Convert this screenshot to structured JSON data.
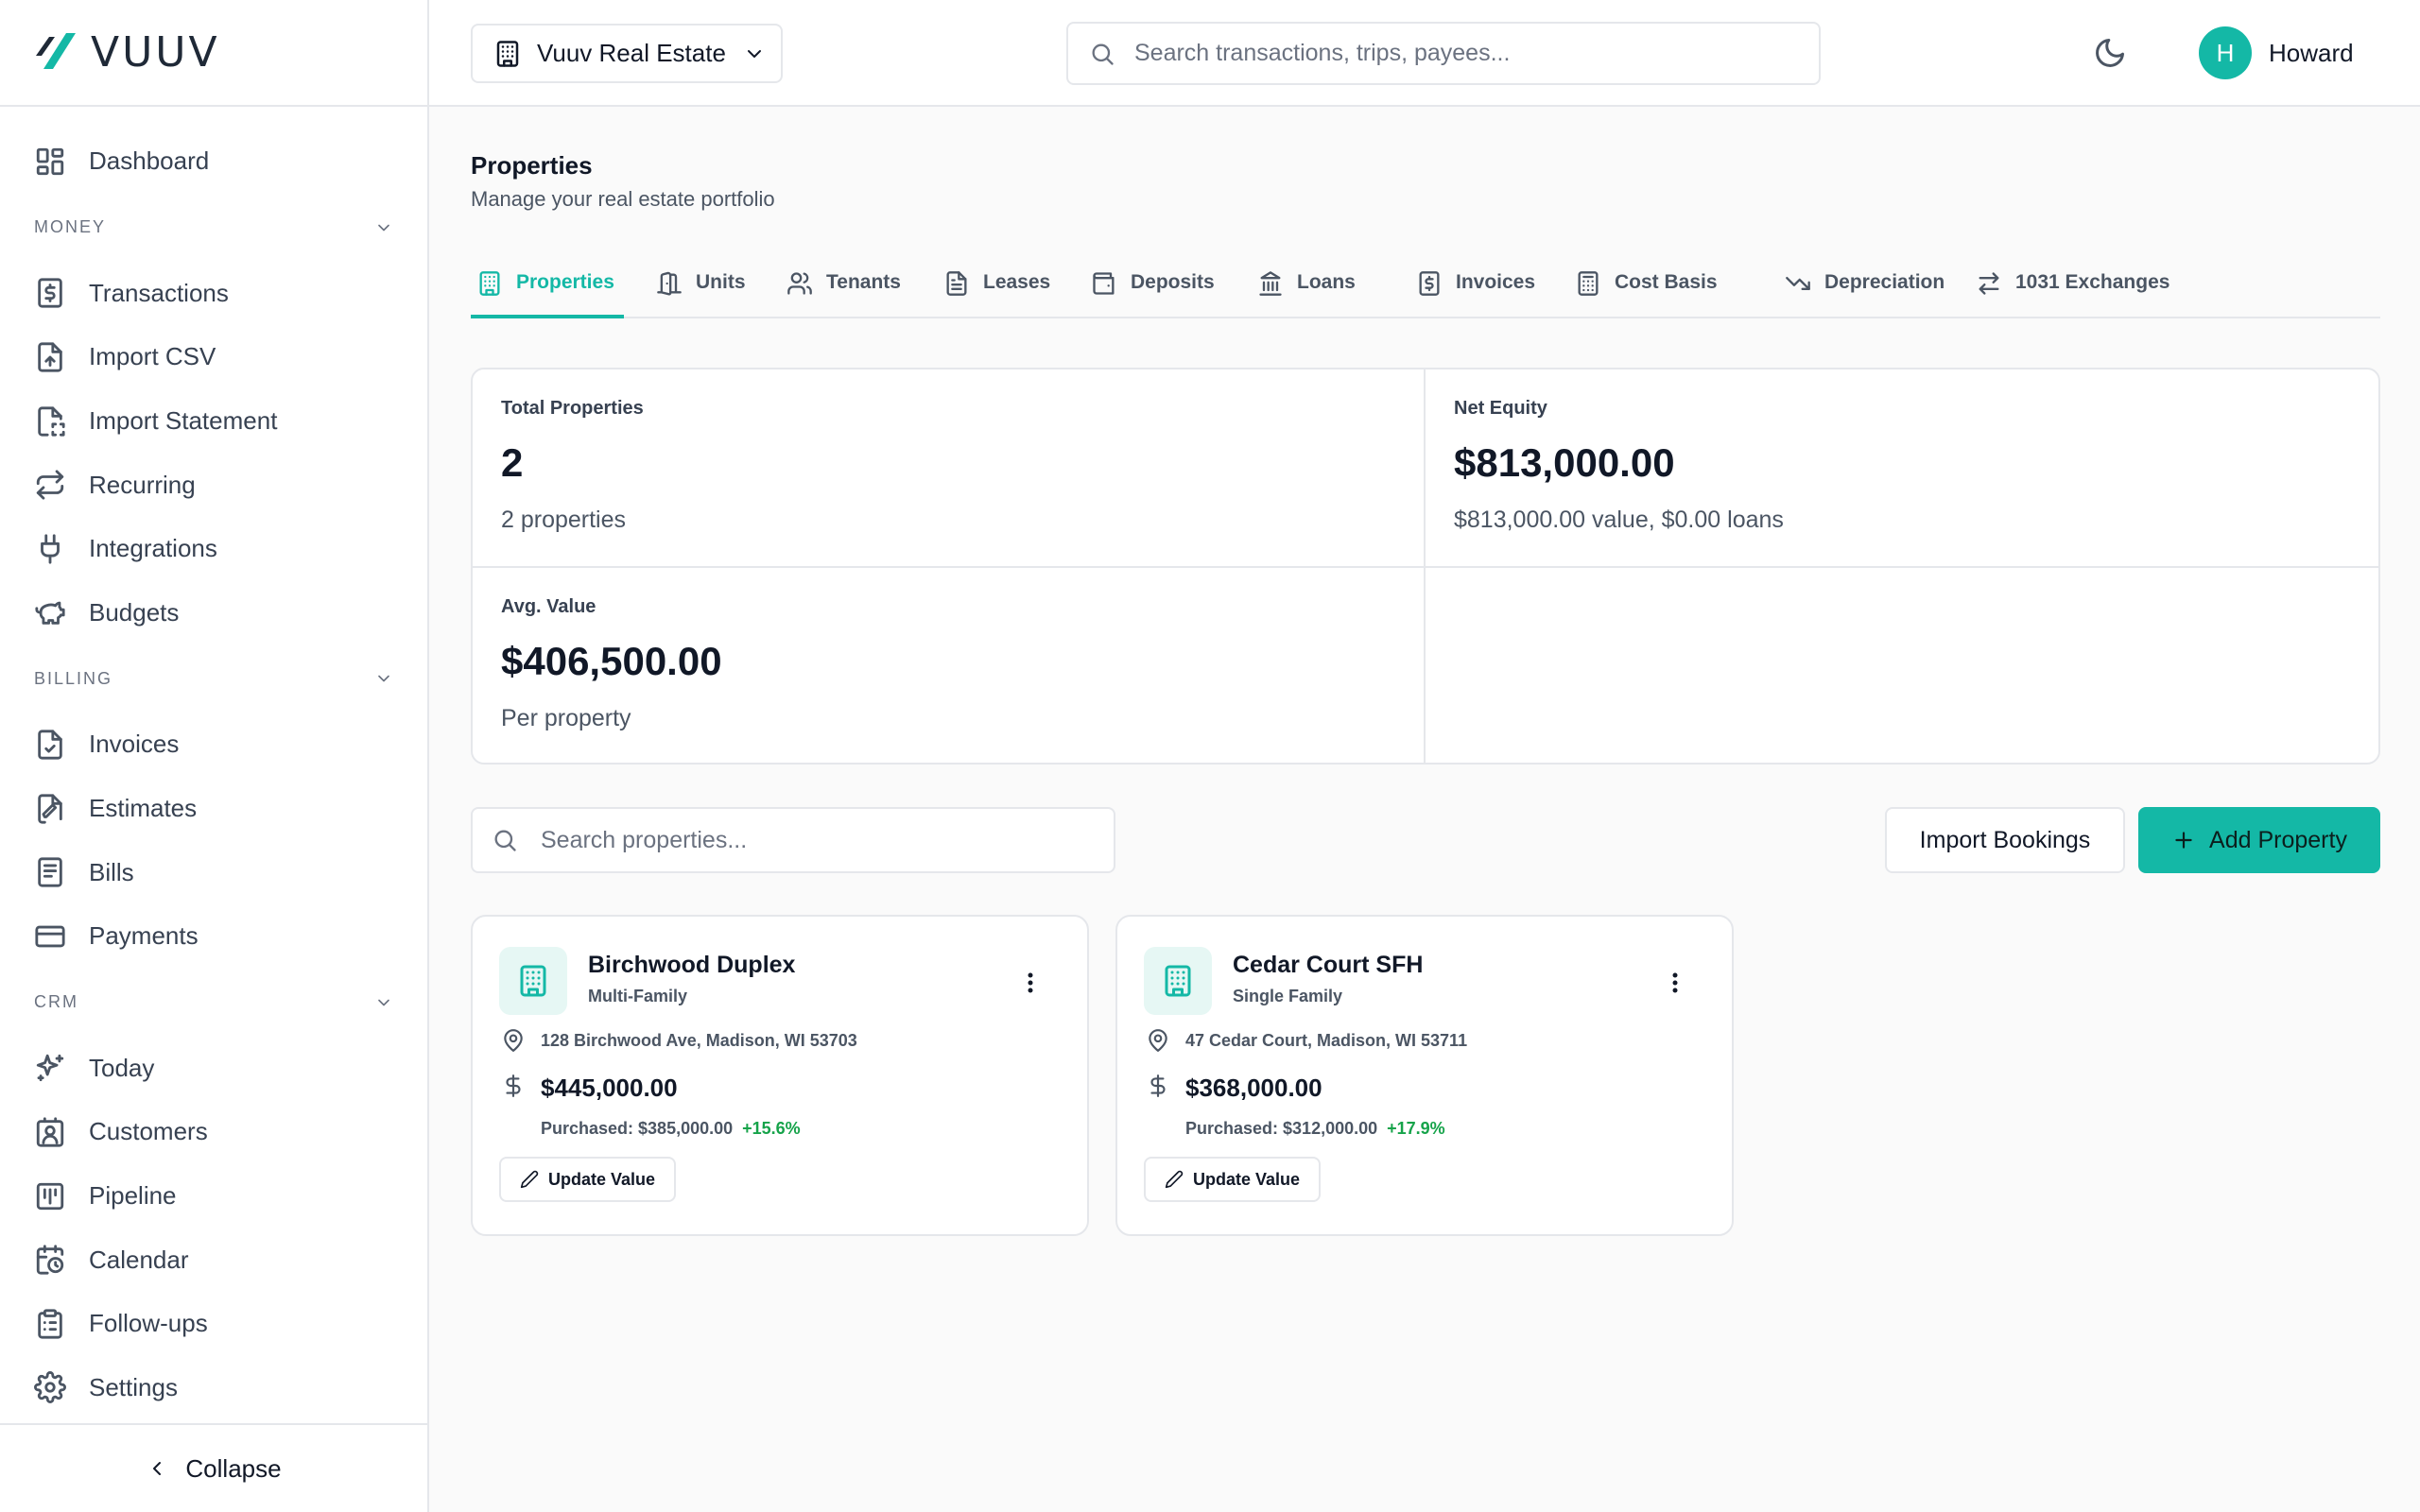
{
  "brand": {
    "name": "VUUV"
  },
  "colors": {
    "accent": "#14b8a6",
    "positive": "#16a34a",
    "border": "#e5e7eb"
  },
  "sidebar": {
    "top_items": [
      {
        "label": "Dashboard",
        "icon": "dashboard-icon"
      }
    ],
    "sections": [
      {
        "title": "MONEY",
        "items": [
          {
            "label": "Transactions",
            "icon": "receipt-dollar-icon"
          },
          {
            "label": "Import CSV",
            "icon": "file-upload-icon"
          },
          {
            "label": "Import Statement",
            "icon": "file-scan-icon"
          },
          {
            "label": "Recurring",
            "icon": "repeat-icon"
          },
          {
            "label": "Integrations",
            "icon": "plug-icon"
          },
          {
            "label": "Budgets",
            "icon": "piggy-bank-icon"
          }
        ]
      },
      {
        "title": "BILLING",
        "items": [
          {
            "label": "Invoices",
            "icon": "file-check-icon"
          },
          {
            "label": "Estimates",
            "icon": "file-signature-icon"
          },
          {
            "label": "Bills",
            "icon": "bill-icon"
          },
          {
            "label": "Payments",
            "icon": "credit-card-icon"
          }
        ]
      },
      {
        "title": "CRM",
        "items": [
          {
            "label": "Today",
            "icon": "sparkles-icon"
          },
          {
            "label": "Customers",
            "icon": "contact-icon"
          },
          {
            "label": "Pipeline",
            "icon": "pipeline-icon"
          },
          {
            "label": "Calendar",
            "icon": "calendar-clock-icon"
          },
          {
            "label": "Follow-ups",
            "icon": "clipboard-list-icon"
          }
        ]
      }
    ],
    "bottom_items": [
      {
        "label": "Settings",
        "icon": "gear-icon"
      }
    ],
    "collapse_label": "Collapse"
  },
  "header": {
    "org_name": "Vuuv Real Estate",
    "search_placeholder": "Search transactions, trips, payees...",
    "user": {
      "initial": "H",
      "name": "Howard"
    }
  },
  "page": {
    "title": "Properties",
    "subtitle": "Manage your real estate portfolio"
  },
  "tabs": [
    {
      "label": "Properties",
      "icon": "building-icon",
      "active": true
    },
    {
      "label": "Units",
      "icon": "door-icon",
      "active": false
    },
    {
      "label": "Tenants",
      "icon": "users-icon",
      "active": false
    },
    {
      "label": "Leases",
      "icon": "file-text-icon",
      "active": false
    },
    {
      "label": "Deposits",
      "icon": "wallet-icon",
      "active": false
    },
    {
      "label": "Loans",
      "icon": "bank-icon",
      "active": false
    },
    {
      "label": "Invoices",
      "icon": "receipt-dollar-icon",
      "active": false
    },
    {
      "label": "Cost Basis",
      "icon": "calculator-icon",
      "active": false
    },
    {
      "label": "Depreciation",
      "icon": "trending-down-icon",
      "active": false
    },
    {
      "label": "1031 Exchanges",
      "icon": "arrows-exchange-icon",
      "active": false
    }
  ],
  "stats": {
    "total": {
      "label": "Total Properties",
      "value": "2",
      "sub": "2 properties"
    },
    "equity": {
      "label": "Net Equity",
      "value": "$813,000.00",
      "sub": "$813,000.00 value, $0.00 loans"
    },
    "avg": {
      "label": "Avg. Value",
      "value": "$406,500.00",
      "sub": "Per property"
    }
  },
  "toolbar": {
    "search_placeholder": "Search properties...",
    "import_label": "Import Bookings",
    "add_label": "Add Property"
  },
  "properties": [
    {
      "name": "Birchwood Duplex",
      "type": "Multi-Family",
      "address": "128 Birchwood Ave, Madison, WI 53703",
      "value": "$445,000.00",
      "purchased": "Purchased: $385,000.00",
      "change": "+15.6%",
      "update_label": "Update Value"
    },
    {
      "name": "Cedar Court SFH",
      "type": "Single Family",
      "address": "47 Cedar Court, Madison, WI 53711",
      "value": "$368,000.00",
      "purchased": "Purchased: $312,000.00",
      "change": "+17.9%",
      "update_label": "Update Value"
    }
  ]
}
